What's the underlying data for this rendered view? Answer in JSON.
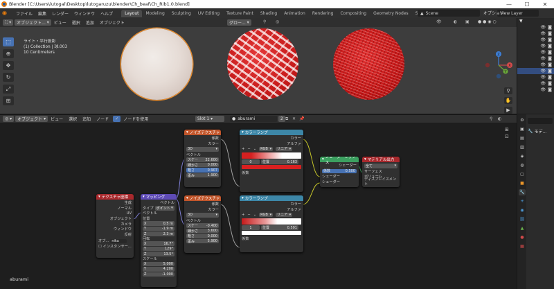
{
  "window": {
    "title": "Blender [C:\\Users\\lutogal\\Desktop\\lutogaruzu\\blender\\Ch_beaf\\Ch_Rib1.0.blend]"
  },
  "menubar": {
    "menus": [
      "ファイル",
      "編集",
      "レンダー",
      "ウィンドウ",
      "ヘルプ"
    ],
    "workspaces": [
      "Layout",
      "Modeling",
      "Sculpting",
      "UV Editing",
      "Texture Paint",
      "Shading",
      "Animation",
      "Rendering",
      "Compositing",
      "Geometry Nodes",
      "Scripting"
    ],
    "active_workspace": "Layout",
    "scene": "Scene",
    "view_layer": "View Layer"
  },
  "viewport": {
    "mode": "オブジェクト...",
    "menus": [
      "ビュー",
      "選択",
      "追加",
      "オブジェクト"
    ],
    "transform": "グロー...",
    "options": "オプション",
    "info_line1": "ライト・平行投影",
    "info_line2": "(1) Collection | 球.003",
    "info_line3": "10 Centimeters",
    "gizmo_x": "X",
    "gizmo_y": "Y",
    "gizmo_z": "Z"
  },
  "node_editor": {
    "mode": "オブジェクト",
    "menus": [
      "ビュー",
      "選択",
      "追加",
      "ノード"
    ],
    "use_nodes": "ノードを使用",
    "slot": "Slot 1",
    "material": "aburami",
    "users": "2",
    "material_label": "aburami",
    "tex_coord": {
      "title": "テクスチャ座標",
      "outputs": [
        "生成",
        "ノーマル",
        "UV",
        "オブジェクト",
        "カメラ",
        "ウィンドウ",
        "反射"
      ],
      "object_label": "オブ...",
      "object_value": "niku",
      "instancer": "インスタンサー..."
    },
    "mapping": {
      "title": "マッピング",
      "out_vector": "ベクトル",
      "type_label": "タイプ",
      "type_value": "ポイント",
      "in_vector": "ベクトル",
      "location": "位置",
      "loc_x": "0.5 m",
      "loc_y": "-1.9 m",
      "loc_z": "2.3 m",
      "rotation": "回転",
      "rot_x": "16.7°",
      "rot_y": "129°",
      "rot_z": "13.5°",
      "scale": "スケール",
      "scl_x": "5.000",
      "scl_y": "4.200",
      "scl_z": "-1.000",
      "axis_x": "X",
      "axis_y": "Y",
      "axis_z": "Z"
    },
    "noise1": {
      "title": "ノイズテクスチャ",
      "out_fac": "係数",
      "out_color": "カラー",
      "dim": "3D",
      "vector": "ベクトル",
      "scale_label": "スケー",
      "scale_value": "22.600",
      "detail_label": "細かさ",
      "detail_value": "0.000",
      "rough_label": "粗さ",
      "rough_value": "0.907",
      "distort_label": "歪み",
      "distort_value": "1.900"
    },
    "noise2": {
      "title": "ノイズテクスチャ",
      "out_fac": "係数",
      "out_color": "カラー",
      "dim": "3D",
      "vector": "ベクトル",
      "scale_label": "スケー",
      "scale_value": "-0.400",
      "detail_label": "細かさ",
      "detail_value": "3.600",
      "rough_label": "粗さ",
      "rough_value": "0.000",
      "distort_label": "歪み",
      "distort_value": "5.900"
    },
    "ramp1": {
      "title": "カラーランプ",
      "out_color": "カラー",
      "out_alpha": "アルファ",
      "mode": "RGB",
      "interp": "リニア",
      "index": "0",
      "pos_label": "位置",
      "pos_value": "0.163",
      "in_fac": "係数"
    },
    "ramp2": {
      "title": "カラーランプ",
      "out_color": "カラー",
      "out_alpha": "アルファ",
      "mode": "RGB",
      "interp": "リニア",
      "index": "1",
      "pos_label": "位置",
      "pos_value": "0.591",
      "in_fac": "係数"
    },
    "mix_shader": {
      "title": "シェーダーミックス",
      "out": "シェーダー",
      "fac_label": "係数",
      "fac_value": "0.500",
      "in1": "シェーダー",
      "in2": "シェーダー"
    },
    "output": {
      "title": "マテリアル出力",
      "target": "全て",
      "surface": "サーフェス",
      "volume": "ボリューム",
      "displacement": "ディスプレイスメント"
    }
  },
  "properties": {
    "label": "モデ..."
  },
  "colors": {
    "accent": "#4772b3",
    "header_orange": "#d0653b",
    "header_texture": "#c2562b",
    "header_converter": "#3d87a8",
    "header_shader": "#3ca060",
    "header_output": "#a8292d",
    "header_input": "#a8292d",
    "header_vector": "#5e4bb5",
    "ramp_red": "#d82020"
  }
}
